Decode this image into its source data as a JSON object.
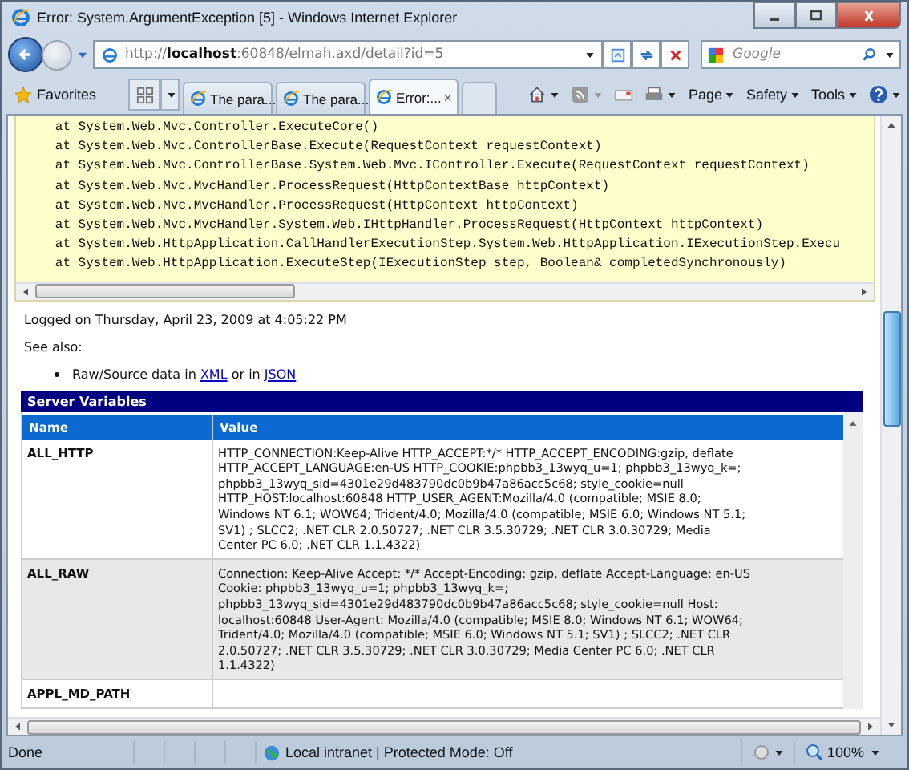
{
  "window": {
    "title": "Error: System.ArgumentException [5] - Windows Internet Explorer"
  },
  "address": {
    "scheme": "http://",
    "host": "localhost",
    "rest": ":60848/elmah.axd/detail?id=5"
  },
  "search": {
    "placeholder": "Google"
  },
  "favorites": "Favorites",
  "tabs": [
    {
      "label": "The para...",
      "selected": false
    },
    {
      "label": "The para...",
      "selected": false
    },
    {
      "label": "Error:...",
      "selected": true
    }
  ],
  "command_menus": [
    "Page",
    "Safety",
    "Tools"
  ],
  "trace_lines": [
    "   at System.Web.Mvc.Controller.ExecuteCore()",
    "   at System.Web.Mvc.ControllerBase.Execute(RequestContext requestContext)",
    "   at System.Web.Mvc.ControllerBase.System.Web.Mvc.IController.Execute(RequestContext requestContext)",
    "   at System.Web.Mvc.MvcHandler.ProcessRequest(HttpContextBase httpContext)",
    "   at System.Web.Mvc.MvcHandler.ProcessRequest(HttpContext httpContext)",
    "   at System.Web.Mvc.MvcHandler.System.Web.IHttpHandler.ProcessRequest(HttpContext httpContext)",
    "   at System.Web.HttpApplication.CallHandlerExecutionStep.System.Web.HttpApplication.IExecutionStep.Execu",
    "   at System.Web.HttpApplication.ExecuteStep(IExecutionStep step, Boolean& completedSynchronously)"
  ],
  "logged": "Logged on Thursday, April 23, 2009 at 4:05:22 PM",
  "see_also": "See also:",
  "raw_source": {
    "before": "Raw/Source data in ",
    "link_1": "XML",
    "middle": " or in ",
    "link_2": "JSON"
  },
  "table": {
    "title": "Server Variables",
    "columns": [
      "Name",
      "Value"
    ],
    "rows": [
      {
        "name": "ALL_HTTP",
        "value": [
          "HTTP_CONNECTION:Keep-Alive HTTP_ACCEPT:*/* HTTP_ACCEPT_ENCODING:gzip, deflate",
          "HTTP_ACCEPT_LANGUAGE:en-US HTTP_COOKIE:phpbb3_13wyq_u=1; phpbb3_13wyq_k=;",
          "phpbb3_13wyq_sid=4301e29d483790dc0b9b47a86acc5c68; style_cookie=null",
          "HTTP_HOST:localhost:60848 HTTP_USER_AGENT:Mozilla/4.0 (compatible; MSIE 8.0;",
          "Windows NT 6.1; WOW64; Trident/4.0; Mozilla/4.0 (compatible; MSIE 6.0; Windows NT 5.1;",
          "SV1) ; SLCC2; .NET CLR 2.0.50727; .NET CLR 3.5.30729; .NET CLR 3.0.30729; Media",
          "Center PC 6.0; .NET CLR 1.1.4322)"
        ]
      },
      {
        "name": "ALL_RAW",
        "value": [
          "Connection: Keep-Alive Accept: */* Accept-Encoding: gzip, deflate Accept-Language: en-US",
          "Cookie: phpbb3_13wyq_u=1; phpbb3_13wyq_k=;",
          "phpbb3_13wyq_sid=4301e29d483790dc0b9b47a86acc5c68; style_cookie=null Host:",
          "localhost:60848 User-Agent: Mozilla/4.0 (compatible; MSIE 8.0; Windows NT 6.1; WOW64;",
          "Trident/4.0; Mozilla/4.0 (compatible; MSIE 6.0; Windows NT 5.1; SV1) ; SLCC2; .NET CLR",
          "2.0.50727; .NET CLR 3.5.30729; .NET CLR 3.0.30729; Media Center PC 6.0; .NET CLR",
          "1.1.4322)"
        ]
      },
      {
        "name": "APPL_MD_PATH",
        "value": []
      }
    ]
  },
  "status_bar": {
    "text": "Done",
    "zone": "Local intranet | Protected Mode: Off",
    "zoom": "100%"
  }
}
